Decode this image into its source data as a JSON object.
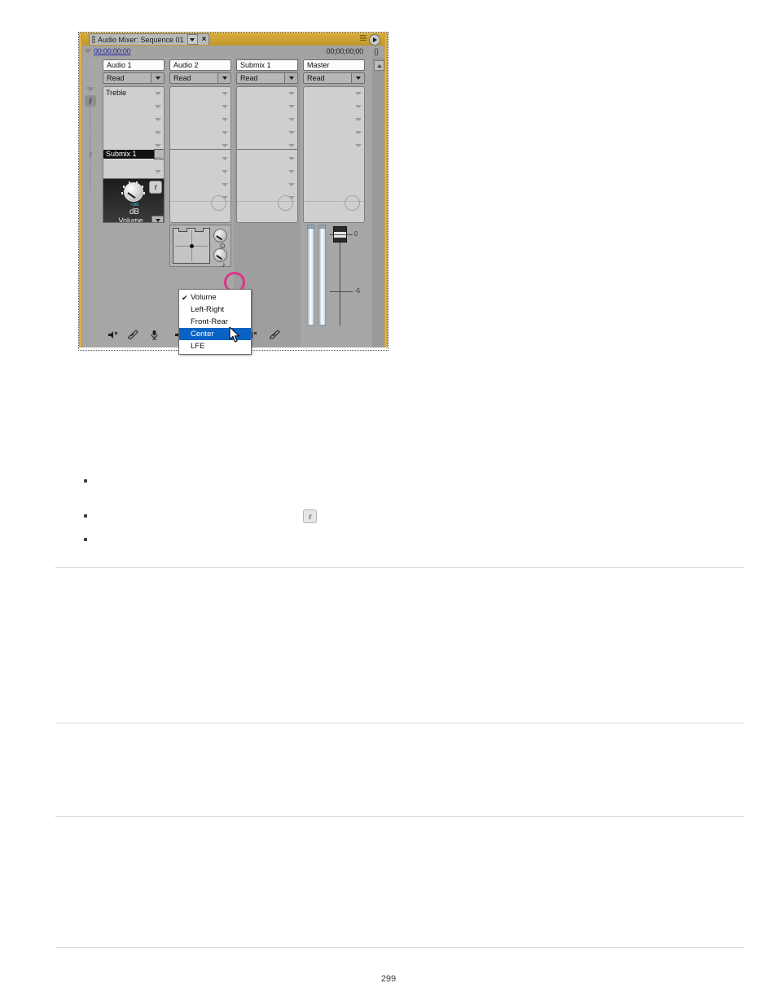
{
  "document": {
    "page_number": "299"
  },
  "figure": {
    "window": {
      "tab_title": "Audio Mixer: Sequence 01",
      "tab_close_glyph": "×",
      "timecode_left": "00;00;00;00",
      "timecode_right": "00;00;00;00",
      "braces_glyph": "{}"
    },
    "tracks": [
      {
        "name": "Audio 1",
        "automation_mode": "Read",
        "effect_slot": "Treble",
        "send_slot": "Submix 1",
        "db_value": "-∞",
        "db_unit": "dB",
        "parameter": "Volume",
        "buttons": [
          "mute-icon",
          "solo-icon",
          "record-icon"
        ]
      },
      {
        "name": "Audio 2",
        "automation_mode": "Read",
        "effect_slot": "",
        "send_slot": "",
        "buttons": [
          "mute-icon",
          "solo-icon",
          "record-icon"
        ]
      },
      {
        "name": "Submix 1",
        "automation_mode": "Read",
        "effect_slot": "",
        "send_slot": "",
        "buttons": [
          "mute-icon",
          "solo-icon"
        ]
      },
      {
        "name": "Master",
        "automation_mode": "Read",
        "effect_slot": "",
        "send_slot": "",
        "buttons": []
      }
    ],
    "dropdown_menu": {
      "check_glyph": "✔",
      "items": [
        {
          "label": "Volume",
          "checked": true,
          "selected": false
        },
        {
          "label": "Left-Right",
          "checked": false,
          "selected": false
        },
        {
          "label": "Front-Rear",
          "checked": false,
          "selected": false
        },
        {
          "label": "Center",
          "checked": false,
          "selected": true
        },
        {
          "label": "LFE",
          "checked": false,
          "selected": false
        }
      ]
    },
    "master_scale": {
      "top_label": "0",
      "mid_label": "-6"
    },
    "annotation": {
      "shape": "ring",
      "color": "#e0338c",
      "target": "parameter-dropdown-arrow"
    },
    "colors": {
      "frame_gold": "#c79a2a",
      "panel_gray": "#a6a6a6",
      "menu_highlight": "#0a63c4",
      "db_readout": "#35c7e8",
      "timecode_link": "#2a2aa8"
    },
    "icons": {
      "rail_fx": "ƒ",
      "rail_send": "ℓ",
      "send_badge": "ℓ",
      "knob_sym_top": "⊙",
      "knob_sym_bottom": "♪"
    }
  }
}
